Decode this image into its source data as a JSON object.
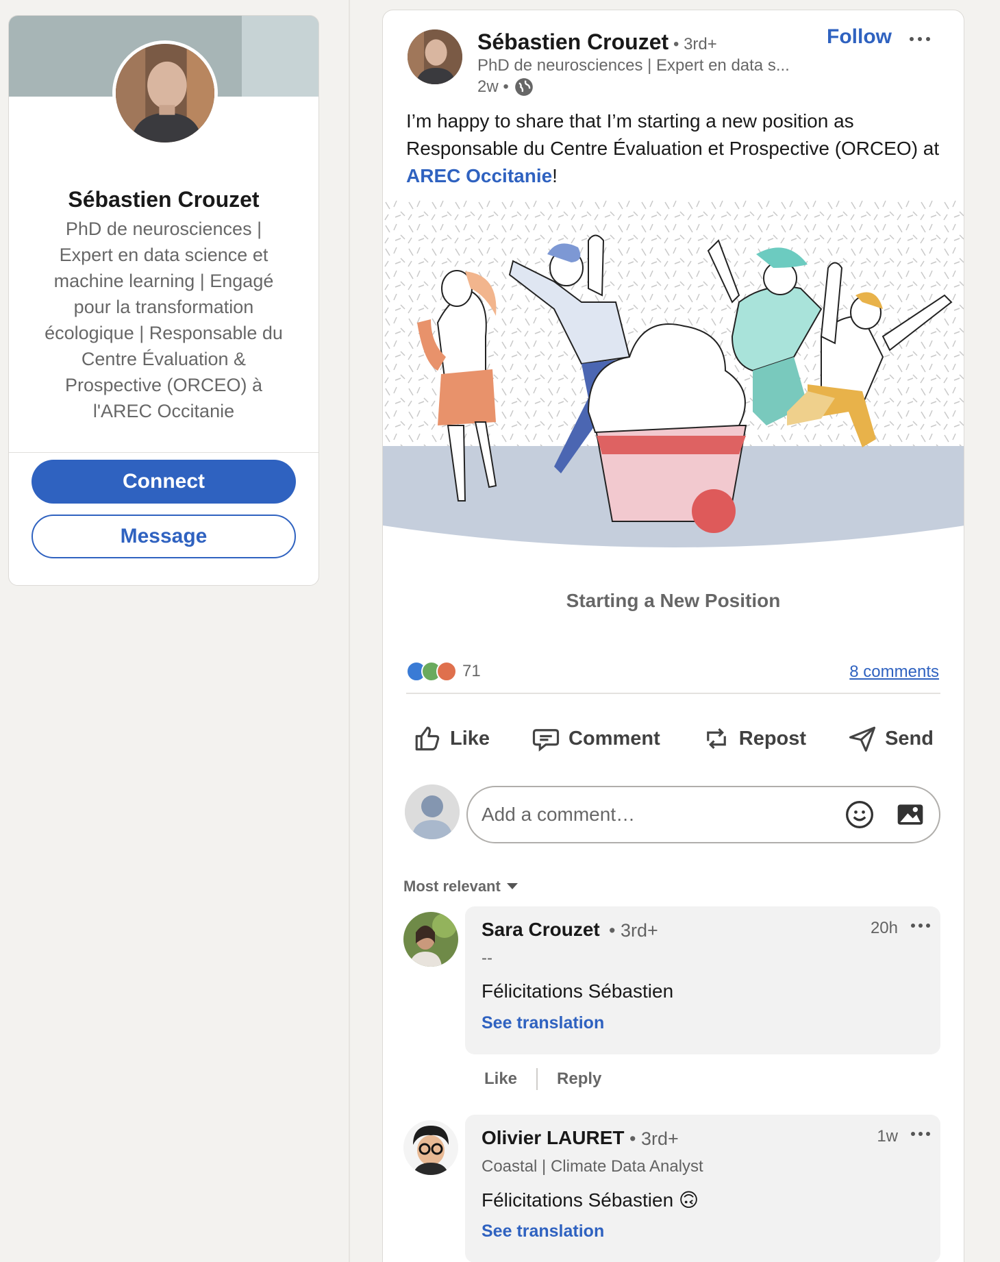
{
  "profile": {
    "name": "Sébastien Crouzet",
    "headline": "PhD de neurosciences | Expert en data science et machine learning | Engagé pour la transformation écologique | Responsable du Centre Évaluation & Prospective (ORCEO) à l'AREC Occitanie",
    "connect_label": "Connect",
    "message_label": "Message"
  },
  "post": {
    "author": "Sébastien Crouzet",
    "degree": "• 3rd+",
    "headline": "PhD de neurosciences | Expert en data s...",
    "age": "2w •",
    "follow_label": "Follow",
    "text_before": "I’m happy to share that I’m starting a new position as Responsable du Centre Évaluation et Prospective (ORCEO) at ",
    "text_link": "AREC Occitanie",
    "text_after": "!",
    "image_caption": "Starting a New Position",
    "reaction_count": "71",
    "comments_link": "8 comments",
    "actions": {
      "like": "Like",
      "comment": "Comment",
      "repost": "Repost",
      "send": "Send"
    },
    "comment_placeholder": "Add a comment…",
    "sort_label": "Most relevant"
  },
  "comments": [
    {
      "name": "Sara Crouzet",
      "degree": "• 3rd+",
      "time": "20h",
      "subtitle": "--",
      "text": "Félicitations Sébastien",
      "translate": "See translation",
      "like": "Like",
      "reply": "Reply"
    },
    {
      "name": "Olivier LAURET",
      "degree": "• 3rd+",
      "time": "1w",
      "subtitle": "Coastal | Climate Data Analyst",
      "text": "Félicitations Sébastien 🙃",
      "translate": "See translation"
    }
  ],
  "colors": {
    "brand_blue": "#2f62c0",
    "page_bg": "#f3f2ef",
    "cover": "#a7b5b6"
  },
  "icons": [
    "globe-icon",
    "more-icon",
    "like-icon",
    "comment-icon",
    "repost-icon",
    "send-icon",
    "emoji-icon",
    "image-icon",
    "caret-down-icon"
  ]
}
